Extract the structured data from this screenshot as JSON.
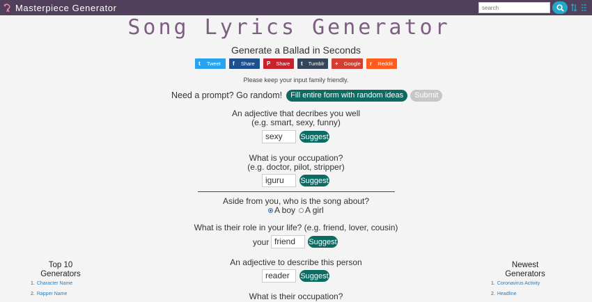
{
  "header": {
    "brand": "Masterpiece Generator",
    "search_placeholder": "search"
  },
  "page": {
    "title": "Song Lyrics Generator",
    "subtitle": "Generate a Ballad in Seconds",
    "note": "Please keep your input family friendly."
  },
  "share": [
    {
      "label": "Tweet",
      "icon": "t",
      "color": "#2aa3ef"
    },
    {
      "label": "Share",
      "icon": "f",
      "color": "#1e4f8f"
    },
    {
      "label": "Share",
      "icon": "P",
      "color": "#c8232c"
    },
    {
      "label": "Tumblr",
      "icon": "t",
      "color": "#35465c"
    },
    {
      "label": "Google",
      "icon": "+",
      "color": "#d23f31"
    },
    {
      "label": "Reddit",
      "icon": "r",
      "color": "#ff5b1c"
    }
  ],
  "prompt": {
    "text": "Need a prompt? Go random!",
    "random_label": "Fill entire form with random ideas",
    "submit_label": "Submit"
  },
  "form": {
    "suggest_label": "Suggest",
    "adjective": {
      "question": "An adjective that decribes you well",
      "hint": "(e.g. smart, sexy, funny)",
      "value": "sexy"
    },
    "occupation": {
      "question": "What is your occupation?",
      "hint": "(e.g. doctor, pilot, stripper)",
      "value": "iguru"
    },
    "subject": {
      "question": "Aside from you, who is the song about?",
      "option_boy": "A boy",
      "option_girl": "A girl"
    },
    "role": {
      "question": "What is their role in your life? (e.g. friend, lover, cousin)",
      "prefix": "your",
      "value": "friend"
    },
    "their_adjective": {
      "question": "An adjective to describe this person",
      "value": "reader"
    },
    "their_occupation": {
      "question": "What is their occupation?"
    }
  },
  "sidebar_left": {
    "heading_line1": "Top 10",
    "heading_line2": "Generators",
    "items": [
      {
        "num": "1.",
        "label": "Character Name"
      },
      {
        "num": "2.",
        "label": "Rapper Name"
      }
    ]
  },
  "sidebar_right": {
    "heading_line1": "Newest",
    "heading_line2": "Generators",
    "items": [
      {
        "num": "1.",
        "label": "Coronavirus Activity"
      },
      {
        "num": "2.",
        "label": "Headline"
      }
    ]
  }
}
